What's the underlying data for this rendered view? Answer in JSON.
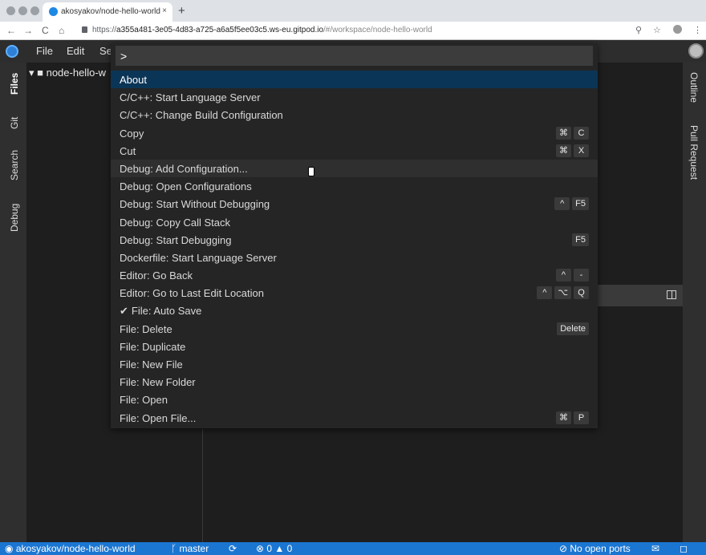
{
  "browser": {
    "tab_title": "akosyakov/node-hello-world",
    "tab_close": "×",
    "new_tab": "+",
    "url_scheme": "https://",
    "url_host": "a355a481-3e05-4d83-a725-a6a5f5ee03c5.ws-eu.gitpod.io",
    "url_path": "/#/workspace/node-hello-world",
    "nav_back": "←",
    "nav_forward": "→",
    "nav_reload": "C",
    "nav_home": "⌂",
    "zoom_icon": "⚲",
    "star_icon": "☆",
    "menu_icon": "⋮"
  },
  "menubar": {
    "items": [
      "File",
      "Edit",
      "Se"
    ]
  },
  "left_tabs": [
    "Files",
    "Git",
    "Search",
    "Debug"
  ],
  "right_tabs": [
    "Outline",
    "Pull Request"
  ],
  "explorer": {
    "root": "▾ ■ node-hello-w"
  },
  "palette": {
    "input_value": ">",
    "items": [
      {
        "label": "About",
        "keys": [],
        "state": "selected"
      },
      {
        "label": "C/C++: Start Language Server",
        "keys": []
      },
      {
        "label": "C/C++: Change Build Configuration",
        "keys": []
      },
      {
        "label": "Copy",
        "keys": [
          "⌘",
          "C"
        ]
      },
      {
        "label": "Cut",
        "keys": [
          "⌘",
          "X"
        ]
      },
      {
        "label": "Debug: Add Configuration...",
        "keys": [],
        "state": "hover"
      },
      {
        "label": "Debug: Open Configurations",
        "keys": []
      },
      {
        "label": "Debug: Start Without Debugging",
        "keys": [
          "^",
          "F5"
        ]
      },
      {
        "label": "Debug: Copy Call Stack",
        "keys": []
      },
      {
        "label": "Debug: Start Debugging",
        "keys": [
          "F5"
        ]
      },
      {
        "label": "Dockerfile: Start Language Server",
        "keys": []
      },
      {
        "label": "Editor: Go Back",
        "keys": [
          "^",
          "-"
        ]
      },
      {
        "label": "Editor: Go to Last Edit Location",
        "keys": [
          "^",
          "⌥",
          "Q"
        ]
      },
      {
        "label": "File: Auto Save",
        "keys": [],
        "checked": true
      },
      {
        "label": "File: Delete",
        "keys": [
          "Delete"
        ]
      },
      {
        "label": "File: Duplicate",
        "keys": []
      },
      {
        "label": "File: New File",
        "keys": []
      },
      {
        "label": "File: New Folder",
        "keys": []
      },
      {
        "label": "File: Open",
        "keys": []
      },
      {
        "label": "File: Open File...",
        "keys": [
          "⌘",
          "P"
        ]
      }
    ]
  },
  "statusbar": {
    "repo": "akosyakov/node-hello-world",
    "branch": "master",
    "sync_icon": "⟳",
    "errors": "0",
    "warnings": "0",
    "ports": "No open ports",
    "chat_icon": "✉",
    "bell_icon": "◻"
  },
  "colors": {
    "accent": "#1b76d2",
    "selected_row": "#0b3556"
  }
}
